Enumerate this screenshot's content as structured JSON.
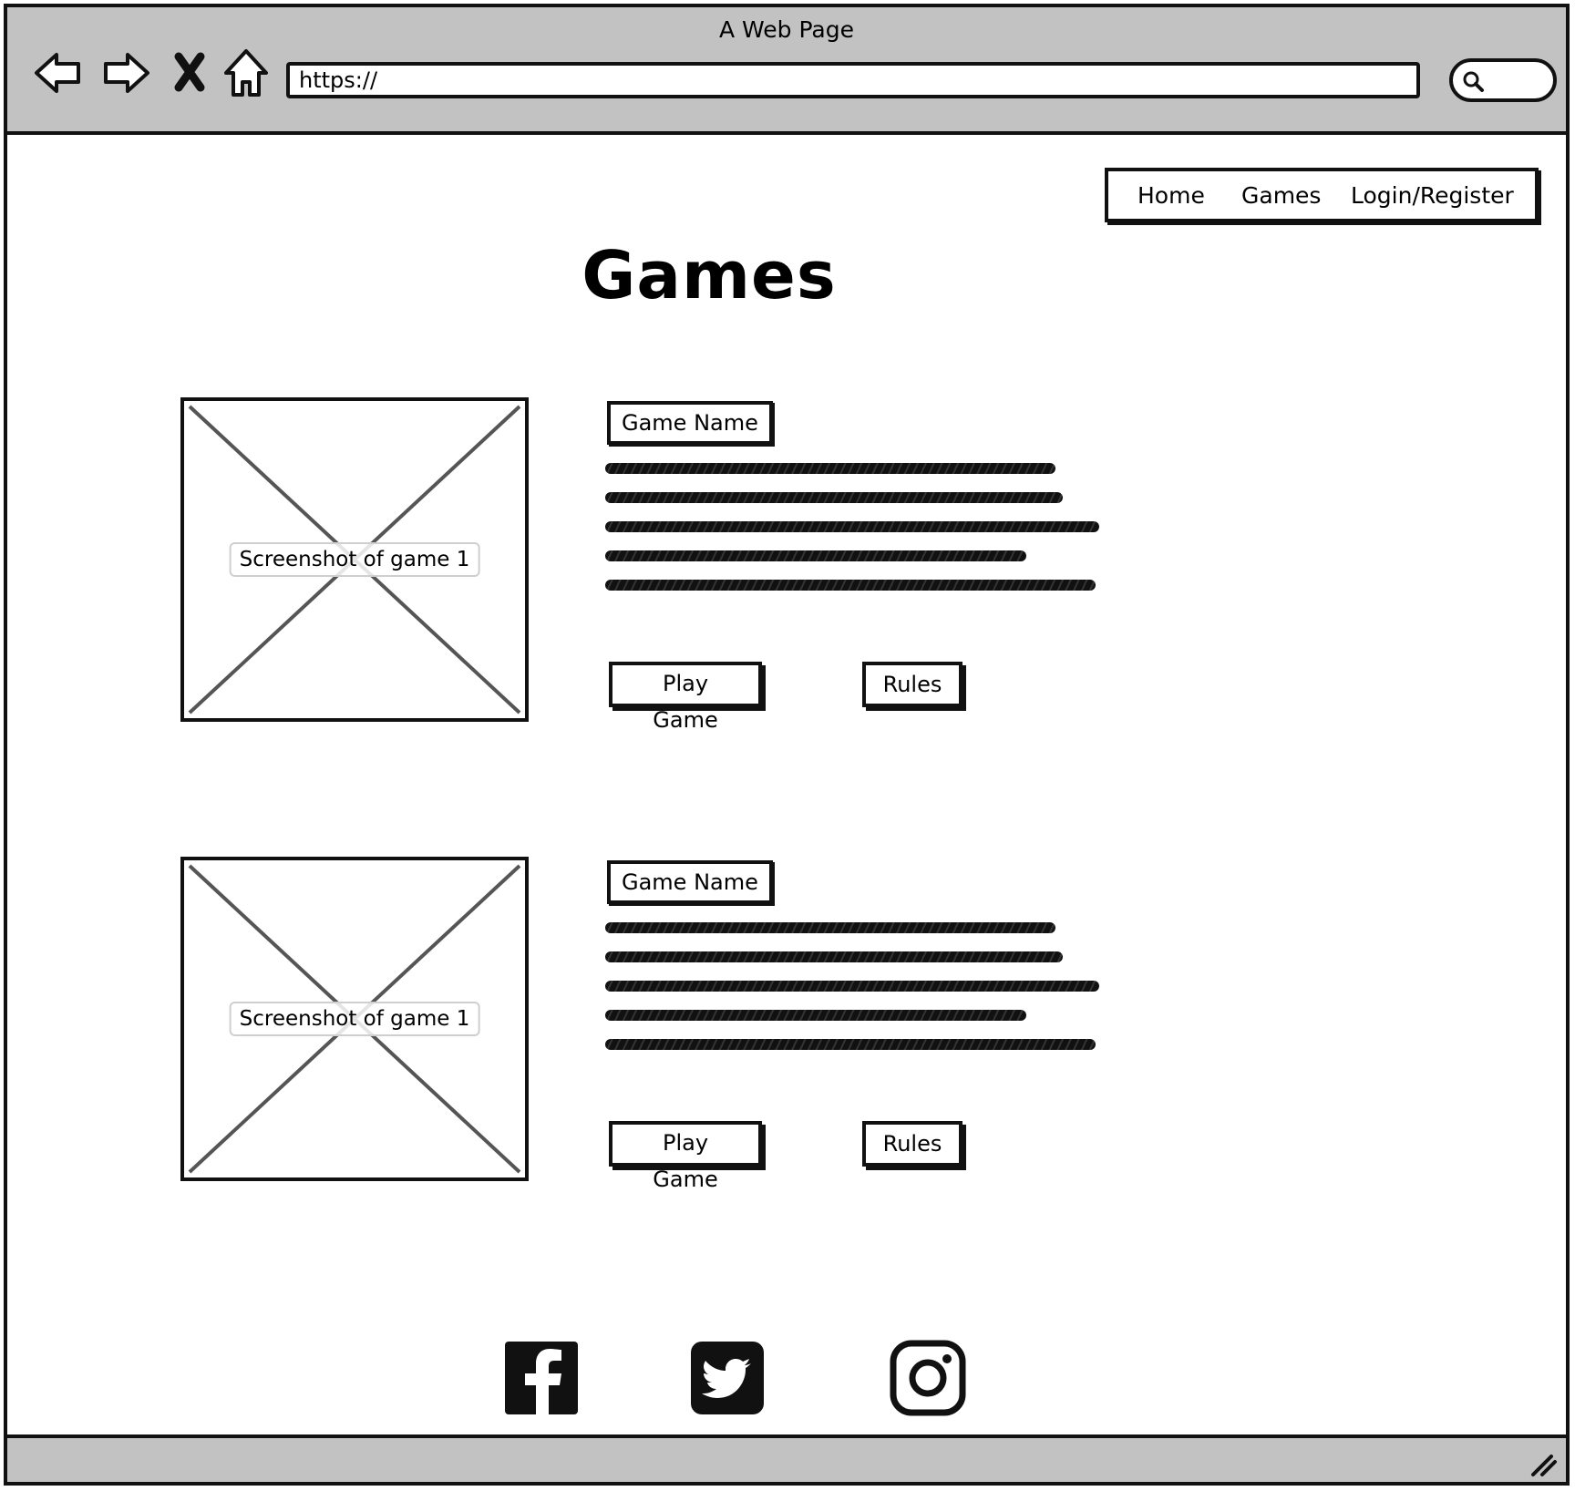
{
  "browser": {
    "window_title": "A Web Page",
    "url": "https://"
  },
  "site_nav": {
    "items": [
      {
        "label": "Home"
      },
      {
        "label": "Games"
      },
      {
        "label": "Login/Register"
      }
    ]
  },
  "page": {
    "title": "Games"
  },
  "games": [
    {
      "screenshot_caption": "Screenshot of game 1",
      "name": "Game Name",
      "play_label": "Play Game",
      "rules_label": "Rules"
    },
    {
      "screenshot_caption": "Screenshot of game 1",
      "name": "Game Name",
      "play_label": "Play Game",
      "rules_label": "Rules"
    }
  ],
  "footer": {
    "social_icons": [
      "facebook-icon",
      "twitter-icon",
      "instagram-icon"
    ]
  }
}
